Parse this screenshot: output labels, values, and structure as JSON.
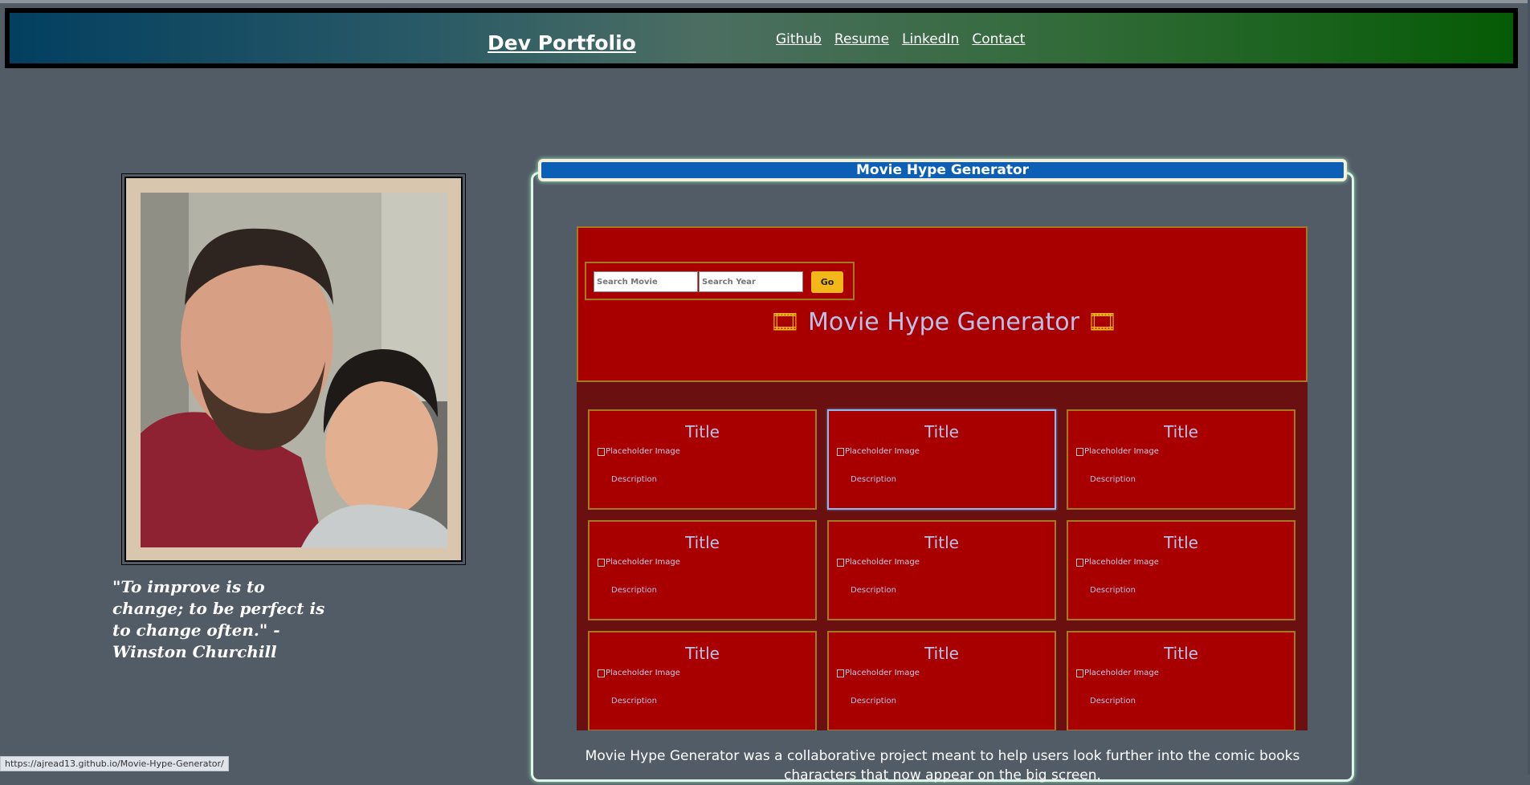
{
  "header": {
    "brand": "Dev Portfolio",
    "nav": [
      "Github",
      "Resume",
      "LinkedIn",
      "Contact"
    ]
  },
  "profile": {
    "quote": "\"To improve is to change; to be perfect is to change often.\" -Winston Churchill"
  },
  "project": {
    "card_title": "Movie Hype Generator",
    "app": {
      "search_movie_placeholder": "Search Movie",
      "search_year_placeholder": "Search Year",
      "go_label": "Go",
      "title": "Movie Hype Generator",
      "film_icon": "film-icon",
      "cards": [
        {
          "title": "Title",
          "image_alt": "Placeholder Image",
          "description": "Description"
        },
        {
          "title": "Title",
          "image_alt": "Placeholder Image",
          "description": "Description"
        },
        {
          "title": "Title",
          "image_alt": "Placeholder Image",
          "description": "Description"
        },
        {
          "title": "Title",
          "image_alt": "Placeholder Image",
          "description": "Description"
        },
        {
          "title": "Title",
          "image_alt": "Placeholder Image",
          "description": "Description"
        },
        {
          "title": "Title",
          "image_alt": "Placeholder Image",
          "description": "Description"
        },
        {
          "title": "Title",
          "image_alt": "Placeholder Image",
          "description": "Description"
        },
        {
          "title": "Title",
          "image_alt": "Placeholder Image",
          "description": "Description"
        },
        {
          "title": "Title",
          "image_alt": "Placeholder Image",
          "description": "Description"
        }
      ]
    },
    "description": "Movie Hype Generator was a collaborative project meant to help users look further into the comic books characters that now appear on the big screen."
  },
  "status_bar": {
    "url": "https://ajread13.github.io/Movie-Hype-Generator/"
  },
  "colors": {
    "background": "#525c66",
    "header_gradient_start": "#023f60",
    "header_gradient_end": "#055b05",
    "project_red": "#a80000",
    "accent_gold": "#f3b719",
    "card_title_blue": "#0d5fb5"
  }
}
